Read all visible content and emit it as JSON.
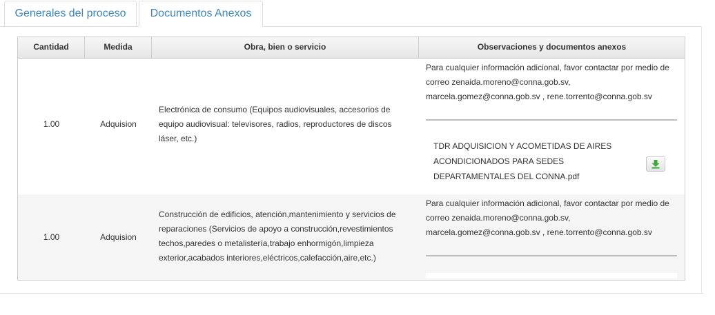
{
  "tabs": [
    {
      "label": "Generales del proceso"
    },
    {
      "label": "Documentos Anexos"
    }
  ],
  "table": {
    "headers": [
      "Cantidad",
      "Medida",
      "Obra, bien o servicio",
      "Observaciones y documentos anexos"
    ],
    "rows": [
      {
        "cantidad": "1.00",
        "medida": "Adquision",
        "obra": "Electrónica de consumo (Equipos audiovisuales, accesorios de equipo audiovisual: televisores, radios, reproductores de discos láser, etc.)",
        "observaciones": "Para cualquier información adicional, favor contactar por medio de correo zenaida.moreno@conna.gob.sv, marcela.gomez@conna.gob.sv , rene.torrento@conna.gob.sv",
        "document": "TDR ADQUISICION Y ACOMETIDAS DE AIRES ACONDICIONADOS PARA SEDES DEPARTAMENTALES DEL CONNA.pdf",
        "download_icon": "download-arrow-icon"
      },
      {
        "cantidad": "1.00",
        "medida": "Adquision",
        "obra": "Construcción de edificios, atención,mantenimiento y servicios de reparaciones (Servicios de apoyo a construcción,revestimientos techos,paredes o metalistería,trabajo enhormigón,limpieza exterior,acabados interiores,eléctricos,calefacción,aire,etc.)",
        "observaciones": "Para cualquier información adicional, favor contactar por medio de correo zenaida.moreno@conna.gob.sv, marcela.gomez@conna.gob.sv , rene.torrento@conna.gob.sv"
      }
    ]
  },
  "colors": {
    "tab_text": "#3b87c7",
    "download_icon": "#3aa935"
  }
}
